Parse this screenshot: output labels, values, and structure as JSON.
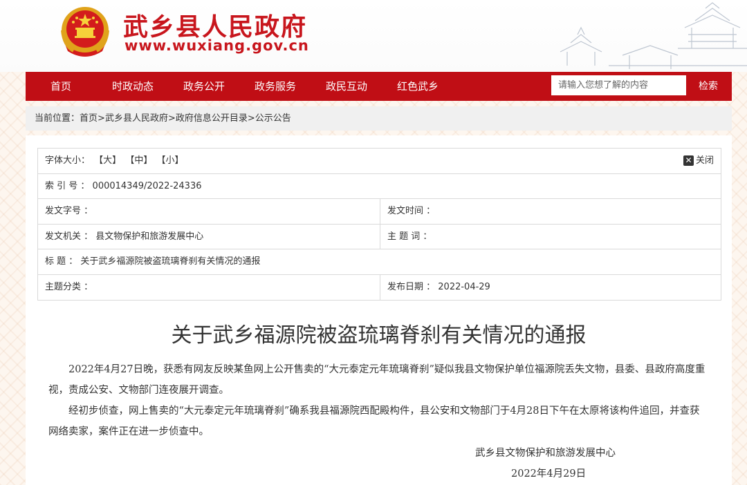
{
  "header": {
    "site_title": "武乡县人民政府",
    "site_url": "www.wuxiang.gov.cn"
  },
  "nav": {
    "items": [
      "首页",
      "时政动态",
      "政务公开",
      "政务服务",
      "政民互动",
      "红色武乡"
    ],
    "search_placeholder": "请输入您想了解的内容",
    "search_button": "检索"
  },
  "breadcrumb": {
    "label": "当前位置：",
    "path": [
      "首页",
      ">",
      "武乡县人民政府",
      ">",
      "政府信息公开目录",
      ">",
      "公示公告"
    ]
  },
  "info": {
    "font_size_label": "字体大小：",
    "font_options": [
      "【大】",
      "【中】",
      "【小】"
    ],
    "close_icon_glyph": "✕",
    "close_label": "关闭",
    "index_label": "索 引 号 ：",
    "index_value": "000014349/2022-24336",
    "doc_no_label": "发文字号 ：",
    "doc_no_value": "",
    "issue_time_label": "发文时间 ：",
    "issue_time_value": "",
    "issuer_label": "发文机关 ：",
    "issuer_value": "县文物保护和旅游发展中心",
    "keywords_label": "主 题 词 ：",
    "keywords_value": "",
    "title_label": "标 题 ：",
    "title_value": "关于武乡福源院被盗琉璃脊刹有关情况的通报",
    "category_label": "主题分类 ：",
    "category_value": "",
    "publish_date_label": "发布日期 ：",
    "publish_date_value": "2022-04-29"
  },
  "article": {
    "title": "关于武乡福源院被盗琉璃脊刹有关情况的通报",
    "paragraphs": [
      "2022年4月27日晚，获悉有网友反映某鱼网上公开售卖的“大元泰定元年琉璃脊刹”疑似我县文物保护单位福源院丢失文物，县委、县政府高度重视，责成公安、文物部门连夜展开调查。",
      "经初步侦查，网上售卖的“大元泰定元年琉璃脊刹”确系我县福源院西配殿构件，县公安和文物部门于4月28日下午在太原将该构件追回，并查获网络卖家，案件正在进一步侦查中。"
    ],
    "signature": "武乡县文物保护和旅游发展中心",
    "date": "2022年4月29日"
  },
  "colors": {
    "brand_red": "#c00e15",
    "title_red": "#c8161d"
  }
}
